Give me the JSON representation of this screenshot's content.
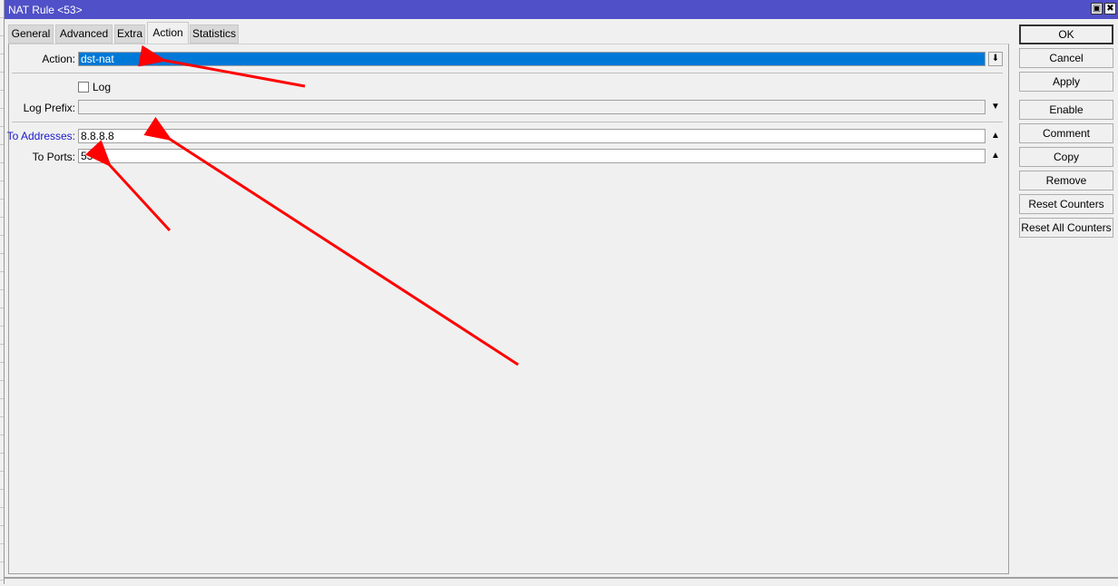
{
  "window": {
    "title": "NAT Rule <53>",
    "restore_icon": "restore-icon",
    "close_icon": "close-icon"
  },
  "tabs": [
    {
      "label": "General",
      "active": false
    },
    {
      "label": "Advanced",
      "active": false
    },
    {
      "label": "Extra",
      "active": false
    },
    {
      "label": "Action",
      "active": true
    },
    {
      "label": "Statistics",
      "active": false
    }
  ],
  "form": {
    "action": {
      "label": "Action:",
      "value": "dst-nat"
    },
    "log": {
      "label": "Log",
      "checked": false
    },
    "log_prefix": {
      "label": "Log Prefix:",
      "value": ""
    },
    "to_addresses": {
      "label": "To Addresses:",
      "value": "8.8.8.8"
    },
    "to_ports": {
      "label": "To Ports:",
      "value": "53"
    }
  },
  "buttons": {
    "ok": "OK",
    "cancel": "Cancel",
    "apply": "Apply",
    "enable": "Enable",
    "comment": "Comment",
    "copy": "Copy",
    "remove": "Remove",
    "reset_counters": "Reset Counters",
    "reset_all_counters": "Reset All Counters"
  },
  "colors": {
    "titlebar": "#5050c8",
    "selection": "#0078d7",
    "annotation_arrow": "#ff0000",
    "link_label": "#1a1acc"
  }
}
